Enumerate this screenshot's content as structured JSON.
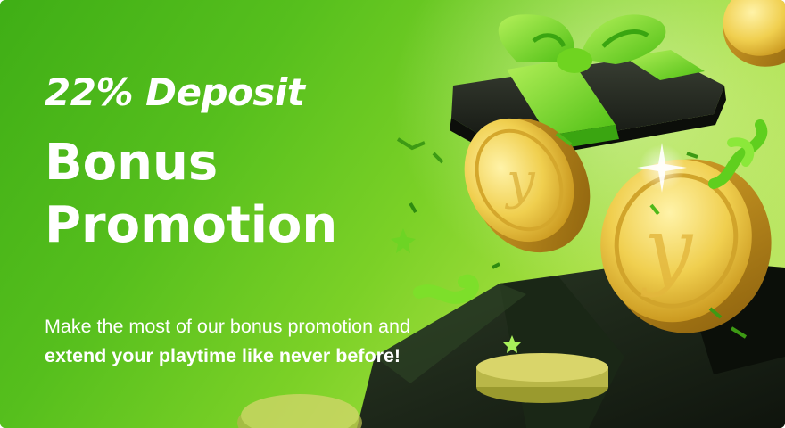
{
  "promo": {
    "title_line_1": "22% Deposit",
    "title_line_2": "Bonus",
    "title_line_3": "Promotion",
    "subtitle_line_1": "Make the most of our bonus promotion and",
    "subtitle_line_2": "extend your playtime like never before!"
  },
  "icons": {
    "gift_box": "gift-box-icon",
    "coin": "gold-coin-icon",
    "confetti": "confetti-ribbon-icon",
    "star": "sparkle-star-icon"
  },
  "colors": {
    "background_start": "#3fae16",
    "background_end": "#c9eb7a",
    "text": "#ffffff",
    "ribbon": "#7ddf2a",
    "gift_box": "#1f2419",
    "coin": "#e6bf3c"
  }
}
